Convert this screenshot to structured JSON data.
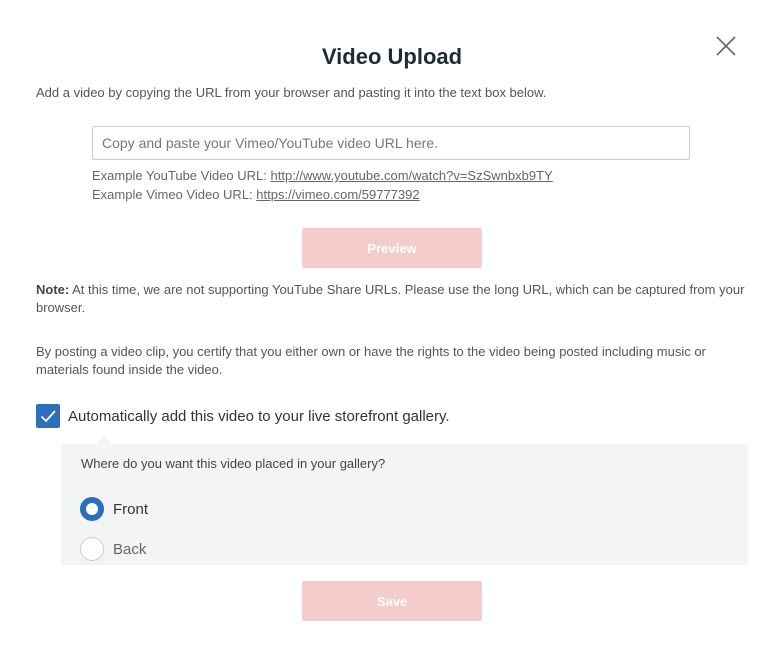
{
  "dialog": {
    "title": "Video Upload",
    "intro": "Add a video by copying the URL from your browser and pasting it into the text box below."
  },
  "url_input": {
    "value": "",
    "placeholder": "Copy and paste your Vimeo/YouTube video URL here."
  },
  "examples": {
    "youtube_label": "Example YouTube Video URL: ",
    "youtube_url": "http://www.youtube.com/watch?v=SzSwnbxb9TY",
    "vimeo_label": "Example Vimeo Video URL: ",
    "vimeo_url": "https://vimeo.com/59777392"
  },
  "buttons": {
    "preview": "Preview",
    "save": "Save",
    "color": "#f4cccc"
  },
  "note": {
    "label": "Note:",
    "text": " At this time, we are not supporting YouTube Share URLs. Please use the long URL, which can be captured from your browser."
  },
  "certify_text": "By posting a video clip, you certify that you either own or have the rights to the video being posted including music or materials found inside the video.",
  "auto_add": {
    "checked": true,
    "label": "Automatically add this video to your live storefront gallery."
  },
  "placement": {
    "question": "Where do you want this video placed in your gallery?",
    "options": [
      {
        "label": "Front",
        "selected": true
      },
      {
        "label": "Back",
        "selected": false
      }
    ]
  },
  "colors": {
    "accent": "#2d6fb8",
    "panel_bg": "#f3f4f6"
  },
  "icons": {
    "close": "close-icon",
    "check": "checkmark-icon"
  }
}
